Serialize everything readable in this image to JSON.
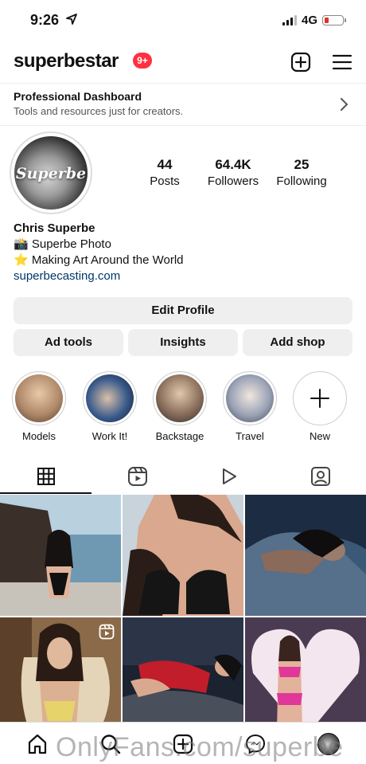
{
  "status_bar": {
    "time": "9:26",
    "network": "4G"
  },
  "header": {
    "username": "superbestar",
    "notifications_badge": "9+"
  },
  "dashboard": {
    "title": "Professional Dashboard",
    "subtitle": "Tools and resources just for creators."
  },
  "profile": {
    "avatar_logo": "Superbe",
    "stats": [
      {
        "value": "44",
        "label": "Posts"
      },
      {
        "value": "64.4K",
        "label": "Followers"
      },
      {
        "value": "25",
        "label": "Following"
      }
    ],
    "name": "Chris Superbe",
    "bio_lines": [
      "📸 Superbe Photo",
      "⭐ Making Art Around the World"
    ],
    "link": "superbecasting.com"
  },
  "buttons": {
    "edit_profile": "Edit Profile",
    "ad_tools": "Ad tools",
    "insights": "Insights",
    "add_shop": "Add shop"
  },
  "highlights": [
    {
      "label": "Models",
      "color": "#b08a6a"
    },
    {
      "label": "Work It!",
      "color": "#3b5b8c"
    },
    {
      "label": "Backstage",
      "color": "#8a6f5c"
    },
    {
      "label": "Travel",
      "color": "#9aa3b5"
    },
    {
      "label": "New"
    }
  ],
  "tabs": [
    "grid-icon",
    "reels-icon",
    "video-icon",
    "tagged-icon"
  ],
  "posts": [
    {
      "colors": [
        "#3f6f8f",
        "#7aa3b8",
        "#2b2420"
      ]
    },
    {
      "colors": [
        "#c9d3db",
        "#d9a88e",
        "#1b1b1b"
      ]
    },
    {
      "colors": [
        "#263b55",
        "#566f8a",
        "#9a7c6b"
      ]
    },
    {
      "colors": [
        "#7c5a3e",
        "#d8c1a0",
        "#e6d36a"
      ],
      "reel": true
    },
    {
      "colors": [
        "#1b2230",
        "#6e2230",
        "#c21d2b"
      ]
    },
    {
      "colors": [
        "#4a3a52",
        "#f3e6ee",
        "#e0389a"
      ]
    }
  ],
  "watermark": "OnlyFans.com/superbe"
}
